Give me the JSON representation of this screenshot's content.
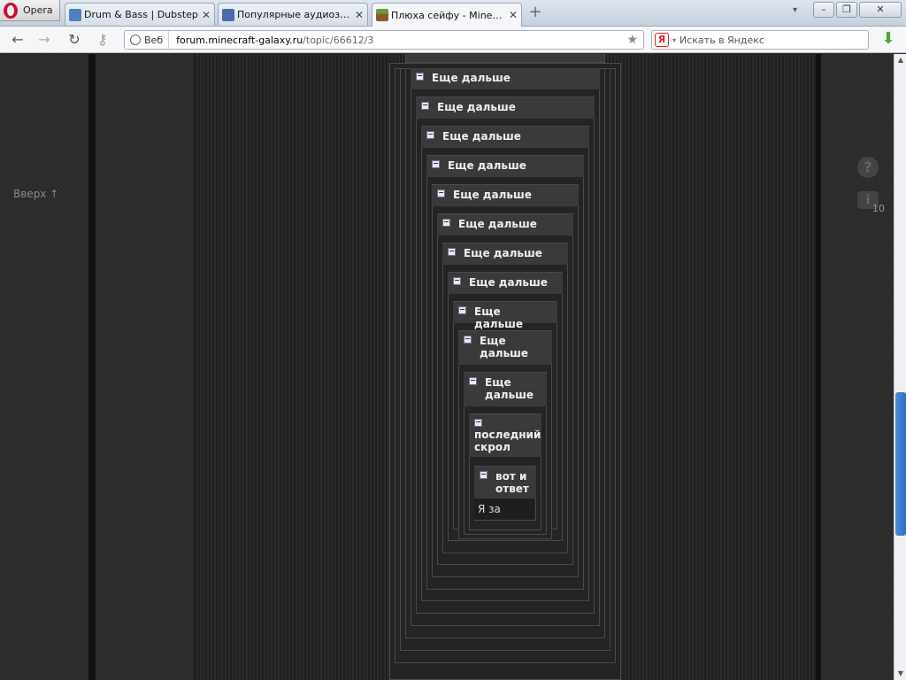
{
  "browser": {
    "menu_label": "Opera",
    "tabs": [
      {
        "label": "Drum & Bass | Dubstep",
        "icon": "pause-icon",
        "color": "#4f81bd"
      },
      {
        "label": "Популярные аудиозаписи",
        "icon": "play-icon",
        "color": "#4a6ea9"
      },
      {
        "label": "Плюха сейфу - Minecraft",
        "icon": "minecraft-grass-icon",
        "color": "#6a9a3a"
      }
    ],
    "new_tab": "+",
    "window_buttons": [
      "–",
      "❐",
      "✕"
    ]
  },
  "address_bar": {
    "badge": "Веб",
    "url_domain": "forum.minecraft-galaxy.ru",
    "url_path": "/topic/66612/3"
  },
  "search": {
    "engine": "Я",
    "placeholder": "Искать в Яндекс"
  },
  "page": {
    "scroll_up": "Вверх ↑",
    "help": "?",
    "info": "i",
    "notification_count": "10"
  },
  "spoilers": [
    {
      "title": "Еще дальше"
    },
    {
      "title": "Еще дальше"
    },
    {
      "title": "Еще дальше"
    },
    {
      "title": "Еще дальше"
    },
    {
      "title": "Еще дальше"
    },
    {
      "title": "Еще дальше"
    },
    {
      "title": "Еще дальше"
    },
    {
      "title": "Еще дальше"
    },
    {
      "title": "Еще дальше"
    },
    {
      "title": "Еще дальше"
    },
    {
      "title": "Еще дальше"
    },
    {
      "title": "последний скрол"
    },
    {
      "title": "вот и ответ"
    }
  ],
  "answer_text": "Я за",
  "colors": {
    "page_bg": "#262626",
    "spoiler_head": "#3a3a3a",
    "scroll_thumb": "#2f6fc2"
  }
}
